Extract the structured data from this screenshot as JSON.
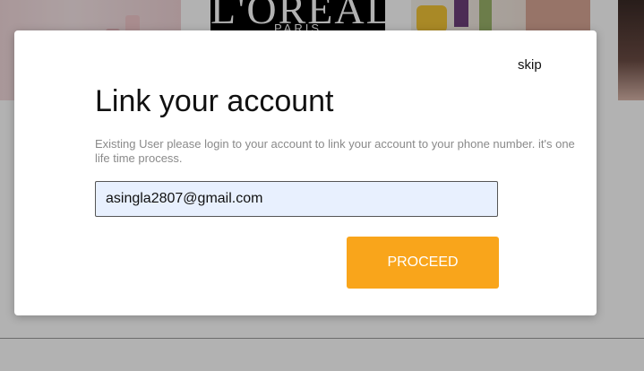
{
  "background": {
    "brand_logo_text": "L'OREAL",
    "brand_logo_subtext": "PARIS"
  },
  "modal": {
    "skip_label": "skip",
    "title": "Link your account",
    "description": "Existing User please login to your account to link your account to your phone number. it's one life time process.",
    "email_value": "asingla2807@gmail.com",
    "proceed_label": "PROCEED"
  },
  "colors": {
    "proceed_button": "#f9a51b",
    "input_background": "#e8f0fe",
    "overlay": "rgba(0,0,0,0.30)"
  }
}
